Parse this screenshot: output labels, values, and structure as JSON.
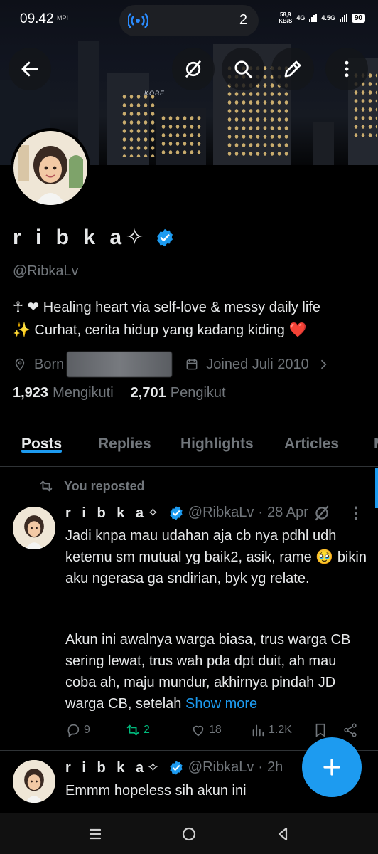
{
  "status_bar": {
    "time": "09.42",
    "small_label": "MPI",
    "hotspot_count": "2",
    "speed_value": "58,9",
    "speed_unit": "KB/S",
    "network_1": "4G",
    "network_2": "4.5G",
    "battery": "90"
  },
  "banner": {
    "sign_text": "KOBE"
  },
  "profile": {
    "display_name": "r i b k a✧",
    "handle": "@RibkaLv",
    "bio_line1": "☥ ❤ Healing heart via self-love & messy daily life",
    "bio_line2": "✨ Curhat, cerita hidup yang kadang kiding ❤️",
    "born_label": "Born",
    "joined": "Joined Juli 2010",
    "following_count": "1,923",
    "following_label": "Mengikuti",
    "followers_count": "2,701",
    "followers_label": "Pengikut"
  },
  "tabs": [
    {
      "label": "Posts",
      "active": true
    },
    {
      "label": "Replies",
      "active": false
    },
    {
      "label": "Highlights",
      "active": false
    },
    {
      "label": "Articles",
      "active": false
    },
    {
      "label": "M",
      "active": false
    }
  ],
  "posts": [
    {
      "repost_label": "You reposted",
      "name": "r i b k a✧",
      "handle": "@RibkaLv",
      "dot": "·",
      "time": "28 Apr",
      "text_p1": "Jadi knpa mau udahan aja cb nya pdhl udh ketemu sm mutual yg baik2, asik, rame 🥹 bikin aku ngerasa ga sndirian, byk yg relate.",
      "text_p2": "Akun ini awalnya warga biasa, trus warga CB sering lewat, trus wah pda dpt duit, ah mau coba ah, maju mundur, akhirnya pindah JD warga CB, setelah",
      "show_more": "Show more",
      "replies": "9",
      "reposts": "2",
      "likes": "18",
      "views": "1.2K"
    },
    {
      "name": "r i b k a✧",
      "handle": "@RibkaLv",
      "dot": "·",
      "time": "2h",
      "text": "Emmm hopeless sih akun ini"
    }
  ],
  "colors": {
    "accent": "#1d9bf0",
    "background": "#000000",
    "text_primary": "#e7e9ea",
    "text_secondary": "#71767b",
    "repost_active": "#00ba7c"
  },
  "icons": {
    "back": "arrow-left-icon",
    "grok": "grok-icon",
    "search": "search-icon",
    "edit": "edit-icon",
    "more": "more-vertical-icon",
    "verified": "verified-badge-icon",
    "location": "location-pin-icon",
    "calendar": "calendar-icon",
    "fab": "plus-icon"
  }
}
